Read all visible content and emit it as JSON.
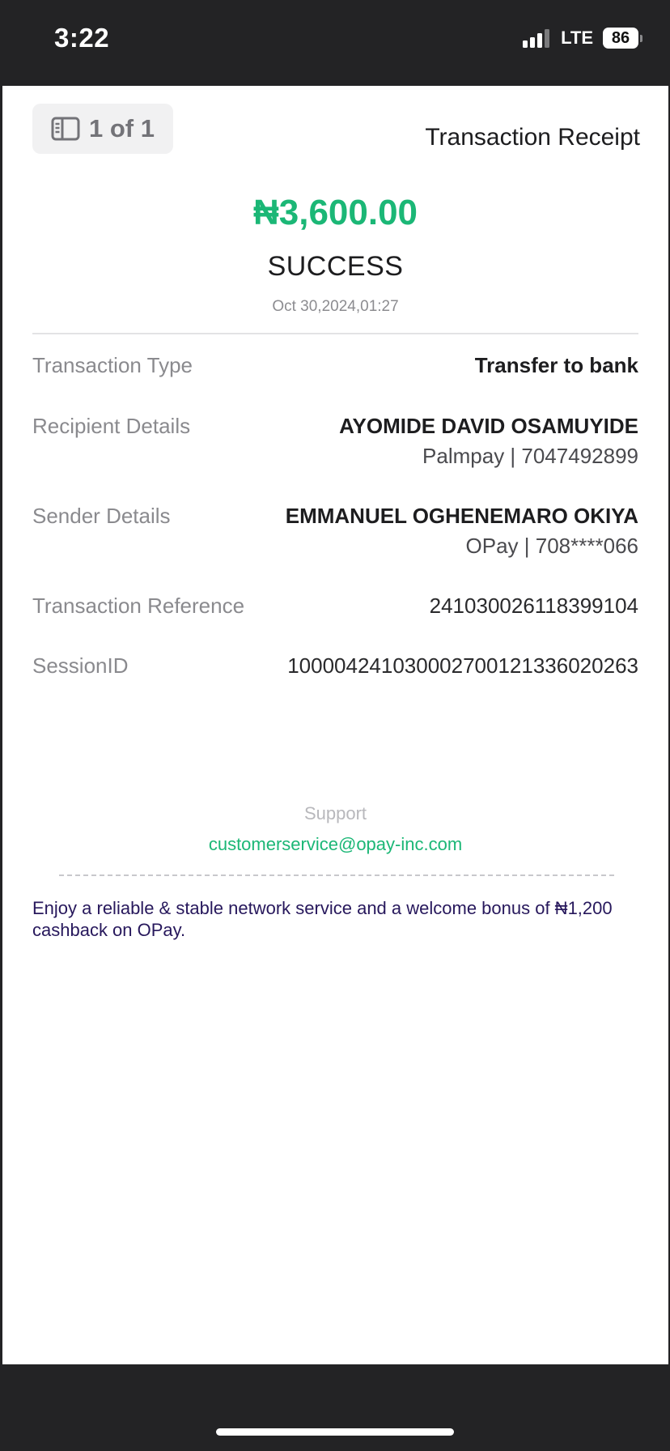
{
  "status_bar": {
    "time": "3:22",
    "network": "LTE",
    "battery": "86"
  },
  "header": {
    "page_indicator": "1 of 1",
    "title": "Transaction Receipt"
  },
  "summary": {
    "amount": "₦3,600.00",
    "status": "SUCCESS",
    "datetime": "Oct 30,2024,01:27"
  },
  "details": [
    {
      "label": "Transaction Type",
      "value": "Transfer to bank"
    },
    {
      "label": "Recipient Details",
      "value": "AYOMIDE DAVID OSAMUYIDE",
      "sub": "Palmpay | 7047492899"
    },
    {
      "label": "Sender Details",
      "value": "EMMANUEL OGHENEMARO OKIYA",
      "sub": "OPay | 708****066"
    },
    {
      "label": "Transaction Reference",
      "value": "241030026118399104"
    },
    {
      "label": "SessionID",
      "value": "100004241030002700121336020263"
    }
  ],
  "support": {
    "label": "Support",
    "email": "customerservice@opay-inc.com"
  },
  "promo": {
    "text": "Enjoy a reliable & stable network service and a welcome bonus of ₦1,200 cashback on OPay."
  },
  "colors": {
    "accent_green": "#1bb776",
    "promo_text": "#27185c",
    "background_dark": "#232325"
  },
  "icons": {
    "page_badge_icon": "sidebar-pages-icon",
    "signal_icon": "cellular-signal-icon",
    "battery_icon": "battery-icon"
  }
}
